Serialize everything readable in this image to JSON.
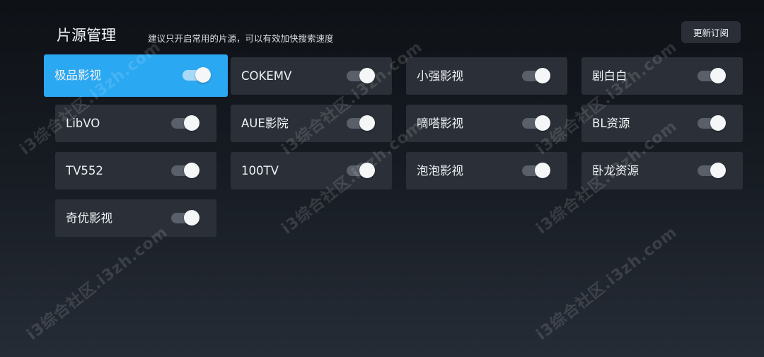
{
  "header": {
    "title": "片源管理",
    "hint": "建议只开启常用的片源，可以有效加快搜索速度",
    "subscribe_button": "更新订阅"
  },
  "sources": [
    {
      "name": "极品影视",
      "enabled": true,
      "active": true
    },
    {
      "name": "COKEMV",
      "enabled": true,
      "active": false
    },
    {
      "name": "小强影视",
      "enabled": true,
      "active": false
    },
    {
      "name": "剧白白",
      "enabled": true,
      "active": false
    },
    {
      "name": "LibVO",
      "enabled": true,
      "active": false
    },
    {
      "name": "AUE影院",
      "enabled": true,
      "active": false
    },
    {
      "name": "嘀嗒影视",
      "enabled": true,
      "active": false
    },
    {
      "name": "BL资源",
      "enabled": true,
      "active": false
    },
    {
      "name": "TV552",
      "enabled": true,
      "active": false
    },
    {
      "name": "100TV",
      "enabled": true,
      "active": false
    },
    {
      "name": "泡泡影视",
      "enabled": true,
      "active": false
    },
    {
      "name": "卧龙资源",
      "enabled": true,
      "active": false
    },
    {
      "name": "奇优影视",
      "enabled": true,
      "active": false
    }
  ],
  "watermark_text": "i3综合社区.i3zh.com",
  "colors": {
    "accent": "#2ba8f2",
    "card": "#2b3038"
  }
}
